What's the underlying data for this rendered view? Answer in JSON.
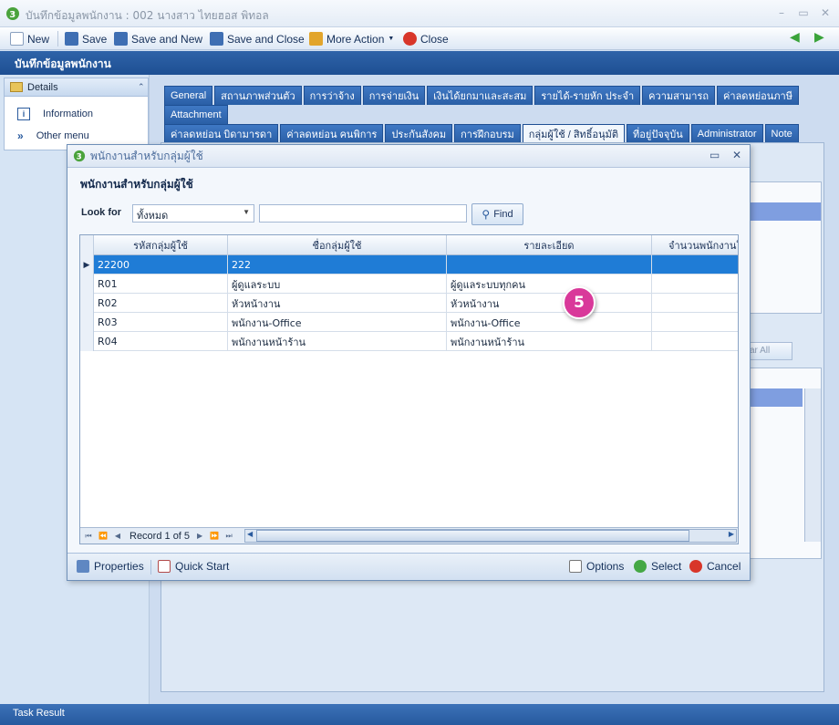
{
  "window": {
    "title": "บันทึกข้อมูลพนักงาน : 002 นางสาว ไทยฮอส พิทอล"
  },
  "toolbar": {
    "new_label": "New",
    "save_label": "Save",
    "save_new_label": "Save and New",
    "save_close_label": "Save and Close",
    "more_action_label": "More Action",
    "close_label": "Close"
  },
  "header": {
    "title": "บันทึกข้อมูลพนักงาน"
  },
  "sidebar": {
    "panel_title": "Details",
    "items": [
      {
        "label": "Information",
        "icon": "info-icon"
      },
      {
        "label": "Other menu",
        "icon": "chevron-double-down-icon"
      }
    ]
  },
  "tabs": {
    "row1": [
      "General",
      "สถานภาพส่วนตัว",
      "การว่าจ้าง",
      "การจ่ายเงิน",
      "เงินได้ยกมาและสะสม",
      "รายได้-รายหัก ประจำ",
      "ความสามารถ",
      "ค่าลดหย่อนภาษี",
      "Attachment"
    ],
    "row2": [
      "ค่าลดหย่อน บิดามารดา",
      "ค่าลดหย่อน คนพิการ",
      "ประกันสังคม",
      "การฝึกอบรม",
      "กลุ่มผู้ใช้ / สิทธิ์อนุมัติ",
      "ที่อยู่ปัจจุบัน",
      "Administrator",
      "Note"
    ],
    "active": "กลุ่มผู้ใช้ / สิทธิ์อนุมัติ"
  },
  "background": {
    "clear_all_label": "ar All"
  },
  "dialog": {
    "title": "พนักงานสำหรับกลุ่มผู้ใช้",
    "heading": "พนักงานสำหรับกลุ่มผู้ใช้",
    "look_for_label": "Look for",
    "look_for_value": "ทั้งหมด",
    "search_value": "",
    "find_label": "Find",
    "grid": {
      "columns": [
        "รหัสกลุ่มผู้ใช้",
        "ชื่อกลุ่มผู้ใช้",
        "รายละเอียด",
        "จำนวนพนักงานใ"
      ],
      "rows": [
        [
          "22200",
          "222",
          "",
          ""
        ],
        [
          "R01",
          "ผู้ดูแลระบบ",
          "ผู้ดูแลระบบทุกคน",
          ""
        ],
        [
          "R02",
          "หัวหน้างาน",
          "หัวหน้างาน",
          ""
        ],
        [
          "R03",
          "พนักงาน-Office",
          "พนักงาน-Office",
          ""
        ],
        [
          "R04",
          "พนักงานหน้าร้าน",
          "พนักงานหน้าร้าน",
          ""
        ]
      ],
      "selected_row": 0,
      "record_text": "Record 1 of 5"
    },
    "badge": "5",
    "footer": {
      "properties_label": "Properties",
      "quick_start_label": "Quick Start",
      "options_label": "Options",
      "select_label": "Select",
      "cancel_label": "Cancel"
    }
  },
  "statusbar": {
    "text": "Task Result"
  },
  "colors": {
    "accent": "#1f7cd6",
    "header": "#1e4f93",
    "badge": "#d9399a"
  }
}
